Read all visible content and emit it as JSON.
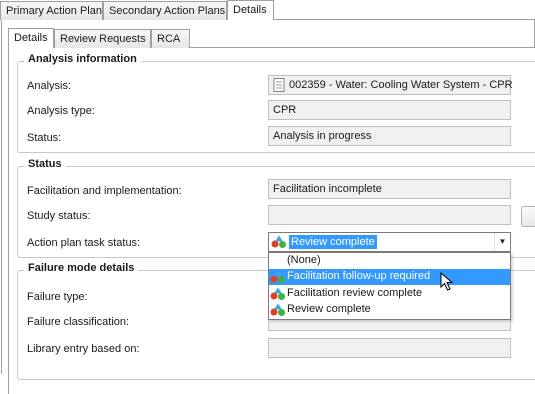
{
  "top_tabs": [
    {
      "label": "Primary Action Plan",
      "active": false
    },
    {
      "label": "Secondary Action Plans",
      "active": false
    },
    {
      "label": "Details",
      "active": true
    }
  ],
  "sub_tabs": [
    {
      "label": "Details",
      "active": true
    },
    {
      "label": "Review Requests",
      "active": false
    },
    {
      "label": "RCA",
      "active": false
    }
  ],
  "analysis_info": {
    "title": "Analysis information",
    "analysis_label": "Analysis:",
    "analysis_value": "002359 - Water: Cooling Water System - CPR",
    "analysis_icon": "document-icon",
    "type_label": "Analysis type:",
    "type_value": "CPR",
    "status_label": "Status:",
    "status_value": "Analysis in progress"
  },
  "status": {
    "title": "Status",
    "facilitation_label": "Facilitation and implementation:",
    "facilitation_value": "Facilitation incomplete",
    "study_label": "Study status:",
    "study_value": "",
    "task_label": "Action plan task status:",
    "task_value": "Review complete",
    "task_icon": "status-shapes-icon"
  },
  "dropdown_options": [
    {
      "label": "(None)",
      "icon": "",
      "highlighted": false
    },
    {
      "label": "Facilitation follow-up required",
      "icon": "status-shapes-icon",
      "highlighted": true
    },
    {
      "label": "Facilitation review complete",
      "icon": "status-shapes-icon",
      "highlighted": false
    },
    {
      "label": "Review complete",
      "icon": "status-shapes-icon",
      "highlighted": false
    }
  ],
  "failure_mode": {
    "title": "Failure mode details",
    "type_label": "Failure type:",
    "classification_label": "Failure classification:",
    "library_label": "Library entry based on:"
  },
  "colors": {
    "selection": "#3399ff",
    "border": "#a0a0a0",
    "readonly_field": "#f0f0f0"
  }
}
